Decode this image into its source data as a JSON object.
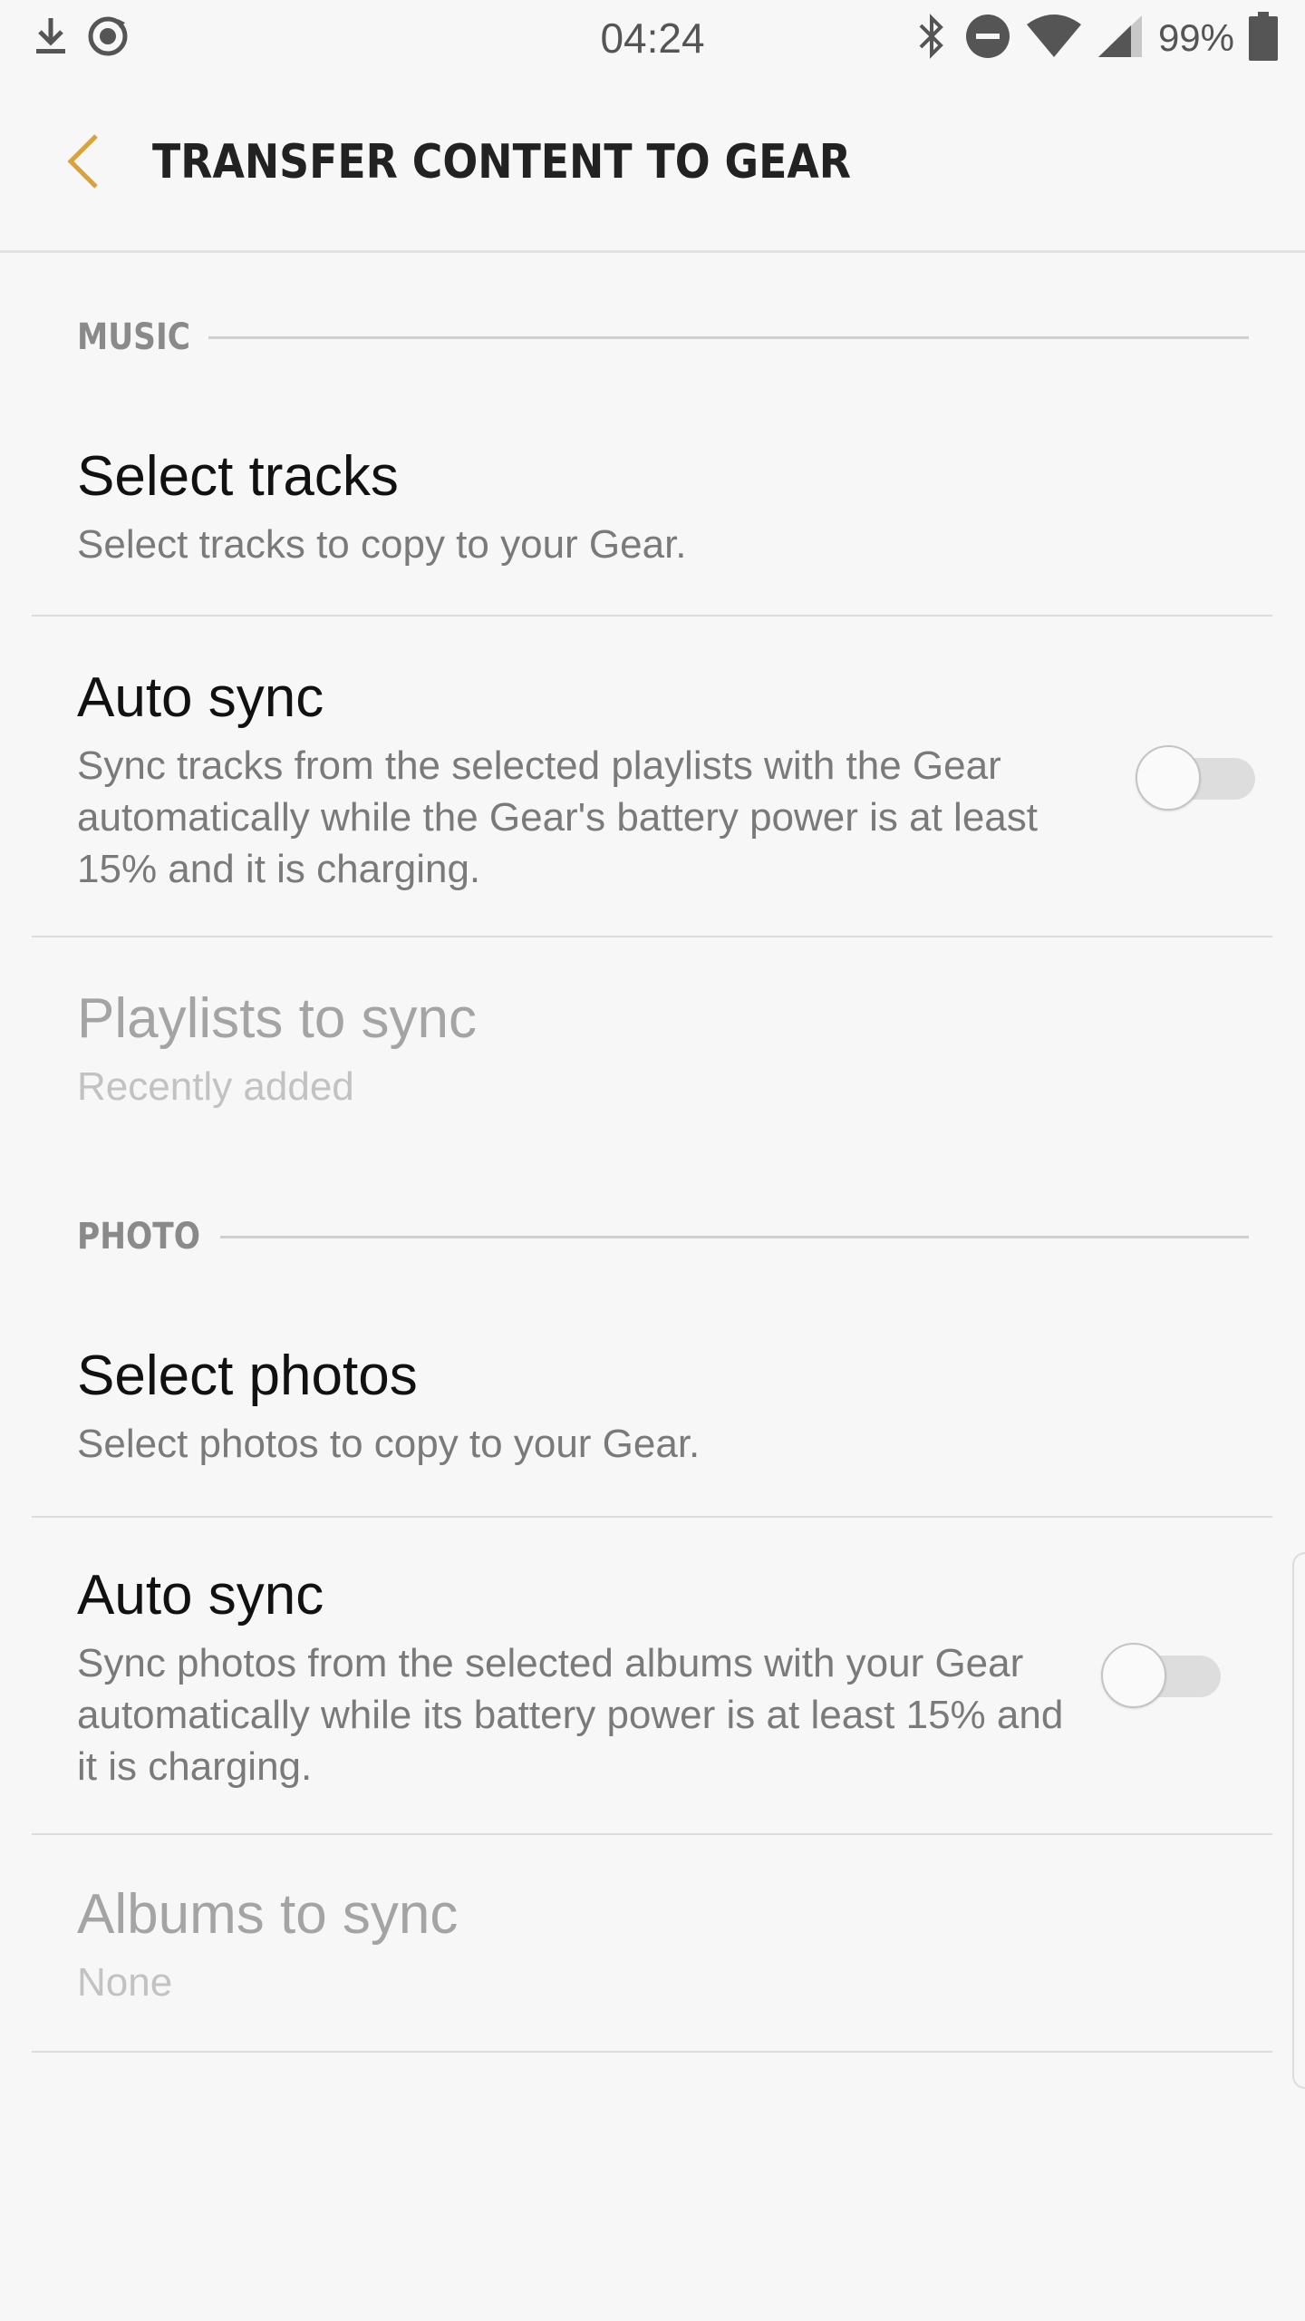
{
  "status_bar": {
    "time": "04:24",
    "battery": "99%",
    "left_icons": [
      "download-icon",
      "sync-circle-icon"
    ],
    "right_icons": [
      "bluetooth-icon",
      "do-not-disturb-icon",
      "wifi-icon",
      "cell-signal-icon",
      "battery-icon"
    ]
  },
  "app_bar": {
    "title": "TRANSFER CONTENT TO GEAR",
    "back_icon": "chevron-left-icon",
    "accent_color": "#d9a23b"
  },
  "sections": {
    "music": {
      "label": "MUSIC",
      "select_tracks": {
        "title": "Select tracks",
        "subtitle": "Select tracks to copy to your Gear."
      },
      "auto_sync": {
        "title": "Auto sync",
        "subtitle": "Sync tracks from the selected playlists with the Gear automatically while the Gear's battery power is at least 15% and it is charging.",
        "enabled": false
      },
      "playlists": {
        "title": "Playlists to sync",
        "value": "Recently added"
      }
    },
    "photo": {
      "label": "PHOTO",
      "select_photos": {
        "title": "Select photos",
        "subtitle": "Select photos to copy to your Gear."
      },
      "auto_sync": {
        "title": "Auto sync",
        "subtitle": "Sync photos from the selected albums with your Gear automatically while its battery power is at least 15% and it is charging.",
        "enabled": false
      },
      "albums": {
        "title": "Albums to sync",
        "value": "None"
      }
    }
  }
}
